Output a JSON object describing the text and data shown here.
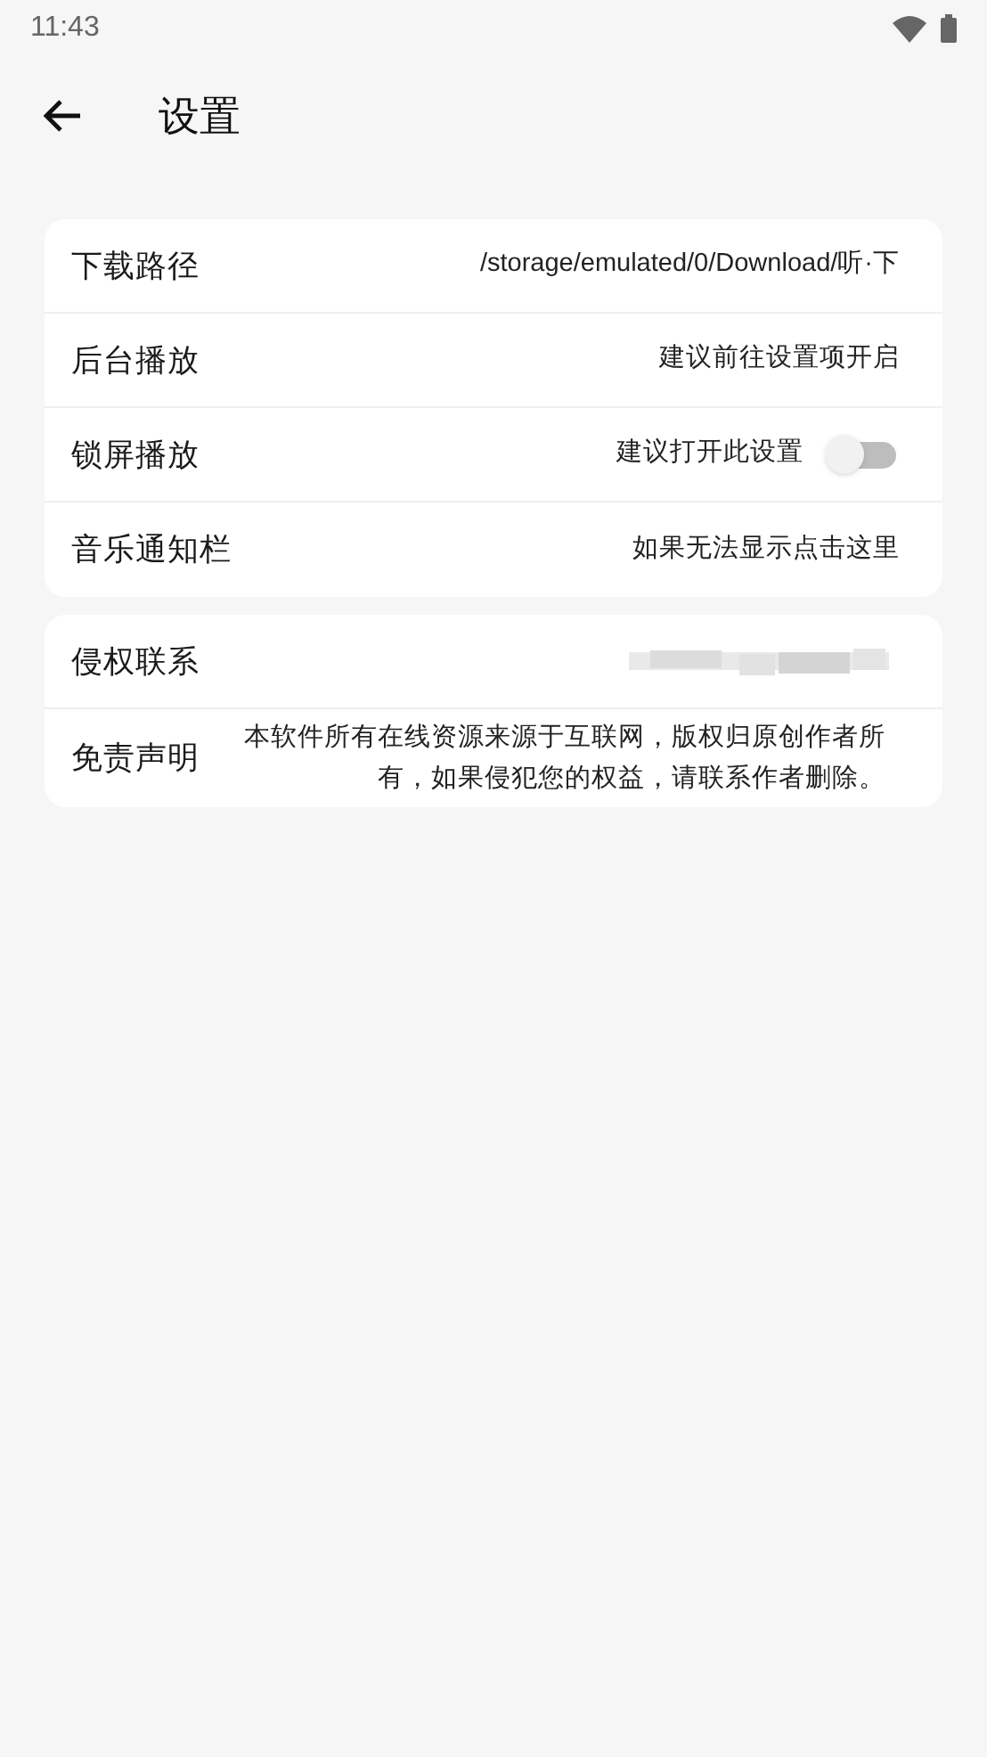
{
  "status_bar": {
    "time": "11:43"
  },
  "header": {
    "title": "设置"
  },
  "groups": [
    {
      "rows": [
        {
          "kind": "text",
          "label": "下载路径",
          "value": "/storage/emulated/0/Download/听·下"
        },
        {
          "kind": "text",
          "label": "后台播放",
          "value": "建议前往设置项开启"
        },
        {
          "kind": "switch",
          "label": "锁屏播放",
          "value": "建议打开此设置",
          "on": false
        },
        {
          "kind": "text",
          "label": "音乐通知栏",
          "value": "如果无法显示点击这里"
        }
      ]
    },
    {
      "rows": [
        {
          "kind": "redacted",
          "label": "侵权联系"
        },
        {
          "kind": "paragraph",
          "label": "免责声明",
          "value": "本软件所有在线资源来源于互联网，版权归原创作者所有，如果侵犯您的权益，请联系作者删除。"
        }
      ]
    }
  ]
}
